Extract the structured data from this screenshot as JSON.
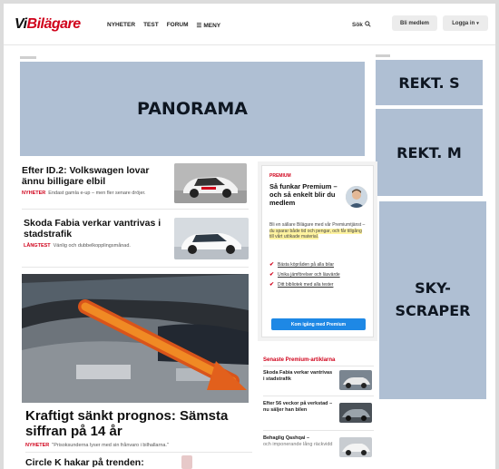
{
  "header": {
    "logo_vi": "Vi",
    "logo_rest": "Bilägare",
    "nav": [
      "NYHETER",
      "TEST",
      "FORUM"
    ],
    "menu_label": "MENY",
    "search_label": "Sök",
    "subscribe_label": "Bli medlem",
    "login_label": "Logga in"
  },
  "ads": {
    "panorama": "PANORAMA",
    "rekt_s": "REKT. S",
    "rekt_m": "REKT. M",
    "sky_line1": "SKY-",
    "sky_line2": "SCRAPER"
  },
  "articles": [
    {
      "title": "Efter ID.2: Volkswagen lovar ännu billigare elbil",
      "tag": "NYHETER",
      "teaser": "Endast gamla e-up – men fler senare dröjer."
    },
    {
      "title": "Skoda Fabia verkar vantrivas i stadstrafik",
      "tag": "LÅNGTEST",
      "teaser": "Vänlig och dubbelkopplingsmånad."
    }
  ],
  "feature": {
    "title_line1": "Kraftigt sänkt prognos: Sämsta",
    "title_line2": "siffran på 14 år",
    "tag": "NYHETER",
    "teaser": "\"Prisoksunderna lyser med sin frånvaro i bilhallarna.\"",
    "next_title": "Circle K hakar på trenden:"
  },
  "premium": {
    "label": "PREMIUM",
    "title": "Så funkar Premium – och så enkelt blir du medlem",
    "body_plain": "Bli en sällare Bilägare med vår Premiumtjänst –",
    "body_highlight": "du sparar både tid och pengar, och får tillgång till vårt utökade material.",
    "checks": [
      "Bästa köpråden på alla bilar",
      "Unika jämförelser och läsvärde",
      "Ditt bibliotek med alla tester"
    ],
    "cta": "Kom igång med Premium"
  },
  "latest": {
    "heading": "Senaste Premium-artiklarna",
    "items": [
      {
        "title": "Skoda Fabia verkar vantrivas i stadstrafik",
        "sub": ""
      },
      {
        "title": "Efter 56 veckor på verkstad – nu säljer han bilen",
        "sub": ""
      },
      {
        "title": "Behaglig Qashqai –",
        "sub": "och imponerande lång räckvidd"
      }
    ]
  }
}
